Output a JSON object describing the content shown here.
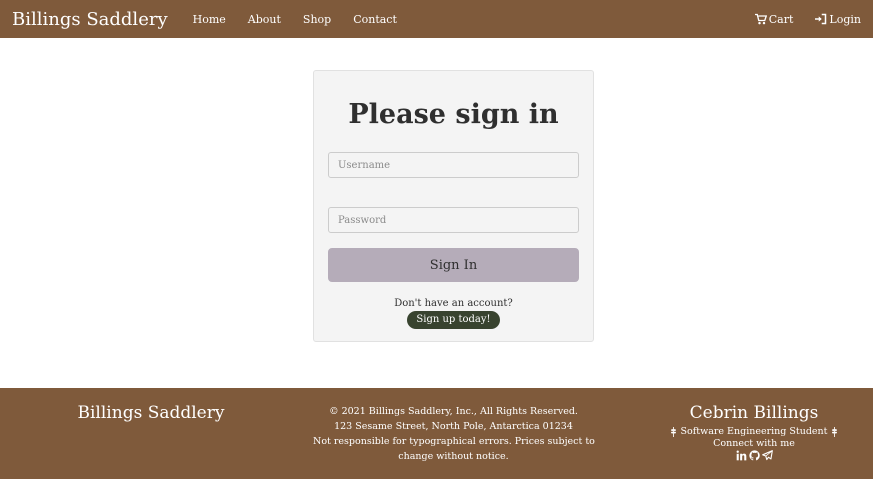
{
  "navbar": {
    "brand": "Billings Saddlery",
    "links": [
      "Home",
      "About",
      "Shop",
      "Contact"
    ],
    "cart_label": "Cart",
    "login_label": "Login"
  },
  "signin": {
    "title": "Please sign in",
    "username_placeholder": "Username",
    "password_placeholder": "Password",
    "submit_label": "Sign In",
    "no_account_text": "Don't have an account?",
    "signup_label": "Sign up today!"
  },
  "footer": {
    "brand": "Billings Saddlery",
    "copyright_lines": [
      "© 2021 Billings Saddlery, Inc., All Rights Reserved.",
      "123 Sesame Street, North Pole, Antarctica 01234",
      "Not responsible for typographical errors. Prices subject to",
      "change without notice."
    ],
    "developer_name": "Cebrin Billings",
    "developer_role": "Software Engineering Student",
    "connect_text": "Connect with me",
    "social_icons": [
      "linkedin-icon",
      "github-icon",
      "telegram-icon"
    ]
  },
  "colors": {
    "brand_brown": "#7f5a3b",
    "card_bg": "#f4f4f4",
    "signin_button": "#b5acb9",
    "signup_button": "#38432f"
  }
}
